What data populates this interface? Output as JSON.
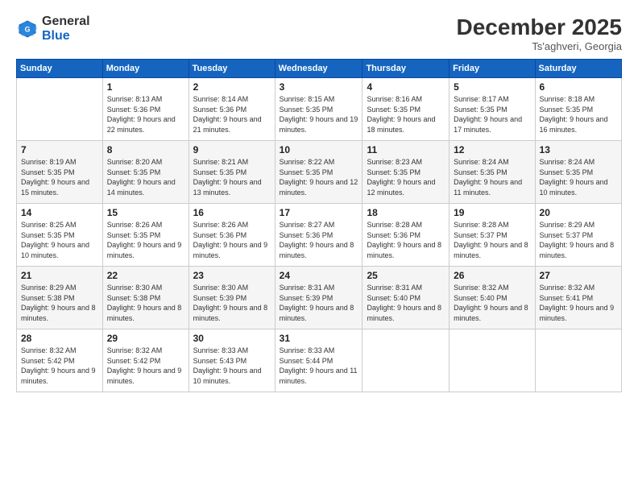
{
  "header": {
    "logo_general": "General",
    "logo_blue": "Blue",
    "month": "December 2025",
    "location": "Ts'aghveri, Georgia"
  },
  "days_of_week": [
    "Sunday",
    "Monday",
    "Tuesday",
    "Wednesday",
    "Thursday",
    "Friday",
    "Saturday"
  ],
  "weeks": [
    [
      {
        "num": "",
        "sunrise": "",
        "sunset": "",
        "daylight": ""
      },
      {
        "num": "1",
        "sunrise": "Sunrise: 8:13 AM",
        "sunset": "Sunset: 5:36 PM",
        "daylight": "Daylight: 9 hours and 22 minutes."
      },
      {
        "num": "2",
        "sunrise": "Sunrise: 8:14 AM",
        "sunset": "Sunset: 5:36 PM",
        "daylight": "Daylight: 9 hours and 21 minutes."
      },
      {
        "num": "3",
        "sunrise": "Sunrise: 8:15 AM",
        "sunset": "Sunset: 5:35 PM",
        "daylight": "Daylight: 9 hours and 19 minutes."
      },
      {
        "num": "4",
        "sunrise": "Sunrise: 8:16 AM",
        "sunset": "Sunset: 5:35 PM",
        "daylight": "Daylight: 9 hours and 18 minutes."
      },
      {
        "num": "5",
        "sunrise": "Sunrise: 8:17 AM",
        "sunset": "Sunset: 5:35 PM",
        "daylight": "Daylight: 9 hours and 17 minutes."
      },
      {
        "num": "6",
        "sunrise": "Sunrise: 8:18 AM",
        "sunset": "Sunset: 5:35 PM",
        "daylight": "Daylight: 9 hours and 16 minutes."
      }
    ],
    [
      {
        "num": "7",
        "sunrise": "Sunrise: 8:19 AM",
        "sunset": "Sunset: 5:35 PM",
        "daylight": "Daylight: 9 hours and 15 minutes."
      },
      {
        "num": "8",
        "sunrise": "Sunrise: 8:20 AM",
        "sunset": "Sunset: 5:35 PM",
        "daylight": "Daylight: 9 hours and 14 minutes."
      },
      {
        "num": "9",
        "sunrise": "Sunrise: 8:21 AM",
        "sunset": "Sunset: 5:35 PM",
        "daylight": "Daylight: 9 hours and 13 minutes."
      },
      {
        "num": "10",
        "sunrise": "Sunrise: 8:22 AM",
        "sunset": "Sunset: 5:35 PM",
        "daylight": "Daylight: 9 hours and 12 minutes."
      },
      {
        "num": "11",
        "sunrise": "Sunrise: 8:23 AM",
        "sunset": "Sunset: 5:35 PM",
        "daylight": "Daylight: 9 hours and 12 minutes."
      },
      {
        "num": "12",
        "sunrise": "Sunrise: 8:24 AM",
        "sunset": "Sunset: 5:35 PM",
        "daylight": "Daylight: 9 hours and 11 minutes."
      },
      {
        "num": "13",
        "sunrise": "Sunrise: 8:24 AM",
        "sunset": "Sunset: 5:35 PM",
        "daylight": "Daylight: 9 hours and 10 minutes."
      }
    ],
    [
      {
        "num": "14",
        "sunrise": "Sunrise: 8:25 AM",
        "sunset": "Sunset: 5:35 PM",
        "daylight": "Daylight: 9 hours and 10 minutes."
      },
      {
        "num": "15",
        "sunrise": "Sunrise: 8:26 AM",
        "sunset": "Sunset: 5:35 PM",
        "daylight": "Daylight: 9 hours and 9 minutes."
      },
      {
        "num": "16",
        "sunrise": "Sunrise: 8:26 AM",
        "sunset": "Sunset: 5:36 PM",
        "daylight": "Daylight: 9 hours and 9 minutes."
      },
      {
        "num": "17",
        "sunrise": "Sunrise: 8:27 AM",
        "sunset": "Sunset: 5:36 PM",
        "daylight": "Daylight: 9 hours and 8 minutes."
      },
      {
        "num": "18",
        "sunrise": "Sunrise: 8:28 AM",
        "sunset": "Sunset: 5:36 PM",
        "daylight": "Daylight: 9 hours and 8 minutes."
      },
      {
        "num": "19",
        "sunrise": "Sunrise: 8:28 AM",
        "sunset": "Sunset: 5:37 PM",
        "daylight": "Daylight: 9 hours and 8 minutes."
      },
      {
        "num": "20",
        "sunrise": "Sunrise: 8:29 AM",
        "sunset": "Sunset: 5:37 PM",
        "daylight": "Daylight: 9 hours and 8 minutes."
      }
    ],
    [
      {
        "num": "21",
        "sunrise": "Sunrise: 8:29 AM",
        "sunset": "Sunset: 5:38 PM",
        "daylight": "Daylight: 9 hours and 8 minutes."
      },
      {
        "num": "22",
        "sunrise": "Sunrise: 8:30 AM",
        "sunset": "Sunset: 5:38 PM",
        "daylight": "Daylight: 9 hours and 8 minutes."
      },
      {
        "num": "23",
        "sunrise": "Sunrise: 8:30 AM",
        "sunset": "Sunset: 5:39 PM",
        "daylight": "Daylight: 9 hours and 8 minutes."
      },
      {
        "num": "24",
        "sunrise": "Sunrise: 8:31 AM",
        "sunset": "Sunset: 5:39 PM",
        "daylight": "Daylight: 9 hours and 8 minutes."
      },
      {
        "num": "25",
        "sunrise": "Sunrise: 8:31 AM",
        "sunset": "Sunset: 5:40 PM",
        "daylight": "Daylight: 9 hours and 8 minutes."
      },
      {
        "num": "26",
        "sunrise": "Sunrise: 8:32 AM",
        "sunset": "Sunset: 5:40 PM",
        "daylight": "Daylight: 9 hours and 8 minutes."
      },
      {
        "num": "27",
        "sunrise": "Sunrise: 8:32 AM",
        "sunset": "Sunset: 5:41 PM",
        "daylight": "Daylight: 9 hours and 9 minutes."
      }
    ],
    [
      {
        "num": "28",
        "sunrise": "Sunrise: 8:32 AM",
        "sunset": "Sunset: 5:42 PM",
        "daylight": "Daylight: 9 hours and 9 minutes."
      },
      {
        "num": "29",
        "sunrise": "Sunrise: 8:32 AM",
        "sunset": "Sunset: 5:42 PM",
        "daylight": "Daylight: 9 hours and 9 minutes."
      },
      {
        "num": "30",
        "sunrise": "Sunrise: 8:33 AM",
        "sunset": "Sunset: 5:43 PM",
        "daylight": "Daylight: 9 hours and 10 minutes."
      },
      {
        "num": "31",
        "sunrise": "Sunrise: 8:33 AM",
        "sunset": "Sunset: 5:44 PM",
        "daylight": "Daylight: 9 hours and 11 minutes."
      },
      {
        "num": "",
        "sunrise": "",
        "sunset": "",
        "daylight": ""
      },
      {
        "num": "",
        "sunrise": "",
        "sunset": "",
        "daylight": ""
      },
      {
        "num": "",
        "sunrise": "",
        "sunset": "",
        "daylight": ""
      }
    ]
  ]
}
